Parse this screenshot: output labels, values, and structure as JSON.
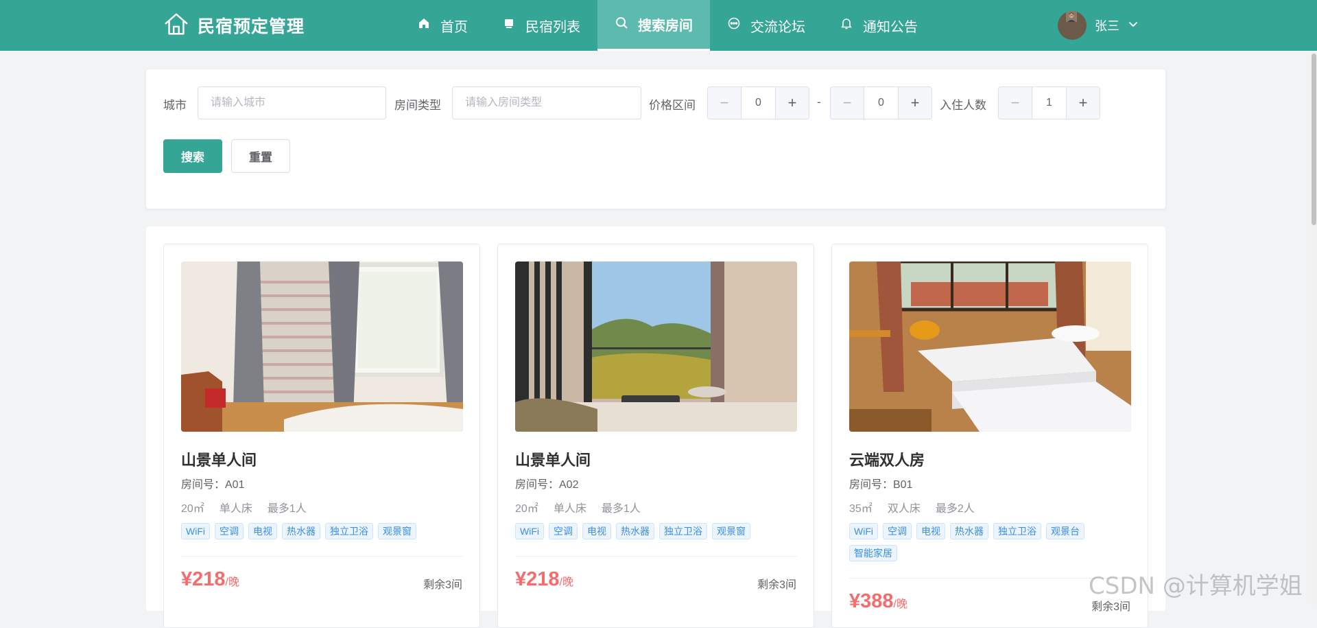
{
  "brand": {
    "title": "民宿预定管理",
    "logo_icon": "house-icon"
  },
  "nav": {
    "items": [
      {
        "label": "首页",
        "icon": "home-icon",
        "active": false
      },
      {
        "label": "民宿列表",
        "icon": "list-icon",
        "active": false
      },
      {
        "label": "搜索房间",
        "icon": "search-icon",
        "active": true
      },
      {
        "label": "交流论坛",
        "icon": "chat-icon",
        "active": false
      },
      {
        "label": "通知公告",
        "icon": "bell-icon",
        "active": false
      }
    ]
  },
  "user": {
    "name": "张三",
    "dropdown_icon": "chevron-down-icon"
  },
  "search": {
    "city_label": "城市",
    "city_placeholder": "请输入城市",
    "city_value": "",
    "room_type_label": "房间类型",
    "room_type_placeholder": "请输入房间类型",
    "room_type_value": "",
    "price_label": "价格区间",
    "price_min": "0",
    "price_max": "0",
    "range_separator": "-",
    "guests_label": "入住人数",
    "guests": "1",
    "minus_symbol": "−",
    "plus_symbol": "+",
    "search_button": "搜索",
    "reset_button": "重置"
  },
  "rooms": [
    {
      "name": "山景单人间",
      "room_no": "房间号：A01",
      "area": "20㎡",
      "bed": "单人床",
      "capacity": "最多1人",
      "tags": [
        "WiFi",
        "空调",
        "电视",
        "热水器",
        "独立卫浴",
        "观景窗"
      ],
      "price": "¥218",
      "price_unit": "/晚",
      "remaining": "剩余3间"
    },
    {
      "name": "山景单人间",
      "room_no": "房间号：A02",
      "area": "20㎡",
      "bed": "单人床",
      "capacity": "最多1人",
      "tags": [
        "WiFi",
        "空调",
        "电视",
        "热水器",
        "独立卫浴",
        "观景窗"
      ],
      "price": "¥218",
      "price_unit": "/晚",
      "remaining": "剩余3间"
    },
    {
      "name": "云端双人房",
      "room_no": "房间号：B01",
      "area": "35㎡",
      "bed": "双人床",
      "capacity": "最多2人",
      "tags": [
        "WiFi",
        "空调",
        "电视",
        "热水器",
        "独立卫浴",
        "观景台",
        "智能家居"
      ],
      "price": "¥388",
      "price_unit": "/晚",
      "remaining": "剩余3间"
    }
  ],
  "watermark": "CSDN @计算机学姐",
  "colors": {
    "primary": "#35a596",
    "nav_active": "#5cbbae",
    "price": "#f56c6c",
    "tag": "#3a8ee6"
  }
}
